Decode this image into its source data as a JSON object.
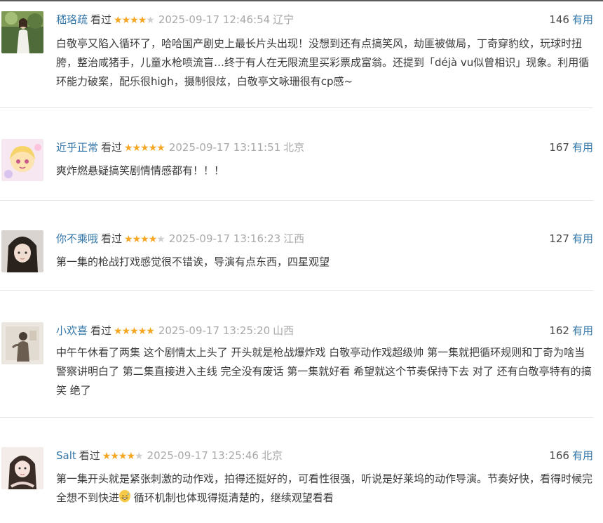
{
  "colors": {
    "link": "#3377aa",
    "star_on": "#f5a623",
    "star_off": "#cfcfcf",
    "meta": "#a9a9a9"
  },
  "reviews": [
    {
      "username": "嵇珞疏",
      "status": "看过",
      "rating": 4,
      "time": "2025-09-17 12:46:54",
      "location": "辽宁",
      "votes": "146",
      "useful": "有用",
      "content": "白敬亭又陷入循环了，哈哈国产剧史上最长片头出现！没想到还有点搞笑风，劫匪被做局，丁奇穿豹纹，玩球时扭胯，整治咸猪手，儿童水枪喷流盲…终于有人在无限流里买彩票成富翁。还提到「déjà vu似曾相识」现象。利用循环能力破案，配乐很high，摄制很炫，白敬亭文咏珊很有cp感~"
    },
    {
      "username": "近乎正常",
      "status": "看过",
      "rating": 5,
      "time": "2025-09-17 13:11:51",
      "location": "北京",
      "votes": "167",
      "useful": "有用",
      "content": "爽炸燃悬疑搞笑剧情情感都有！！！"
    },
    {
      "username": "你不乘哦",
      "status": "看过",
      "rating": 4,
      "time": "2025-09-17 13:16:23",
      "location": "江西",
      "votes": "127",
      "useful": "有用",
      "content": "第一集的枪战打戏感觉很不错诶，导演有点东西，四星观望"
    },
    {
      "username": "小欢喜",
      "status": "看过",
      "rating": 5,
      "time": "2025-09-17 13:25:20",
      "location": "山西",
      "votes": "162",
      "useful": "有用",
      "content": "中午午休看了两集 这个剧情太上头了 开头就是枪战爆炸戏 白敬亭动作戏超级帅 第一集就把循环规则和丁奇为啥当警察讲明白了 第二集直接进入主线 完全没有废话 第一集就好看 希望就这个节奏保持下去 对了 还有白敬亭特有的搞笑 绝了"
    },
    {
      "username": "Salt",
      "status": "看过",
      "rating": 4,
      "time": "2025-09-17 13:25:46",
      "location": "北京",
      "votes": "166",
      "useful": "有用",
      "content_before_emoji": "第一集开头就是紧张刺激的动作戏，拍得还挺好的，可看性很强，听说是好莱坞的动作导演。节奏好快，看得时候完全想不到快进",
      "emoji_icon": "grinning-sweat-emoji",
      "content_after_emoji": " 循环机制也体现得挺清楚的，继续观望看看"
    }
  ]
}
